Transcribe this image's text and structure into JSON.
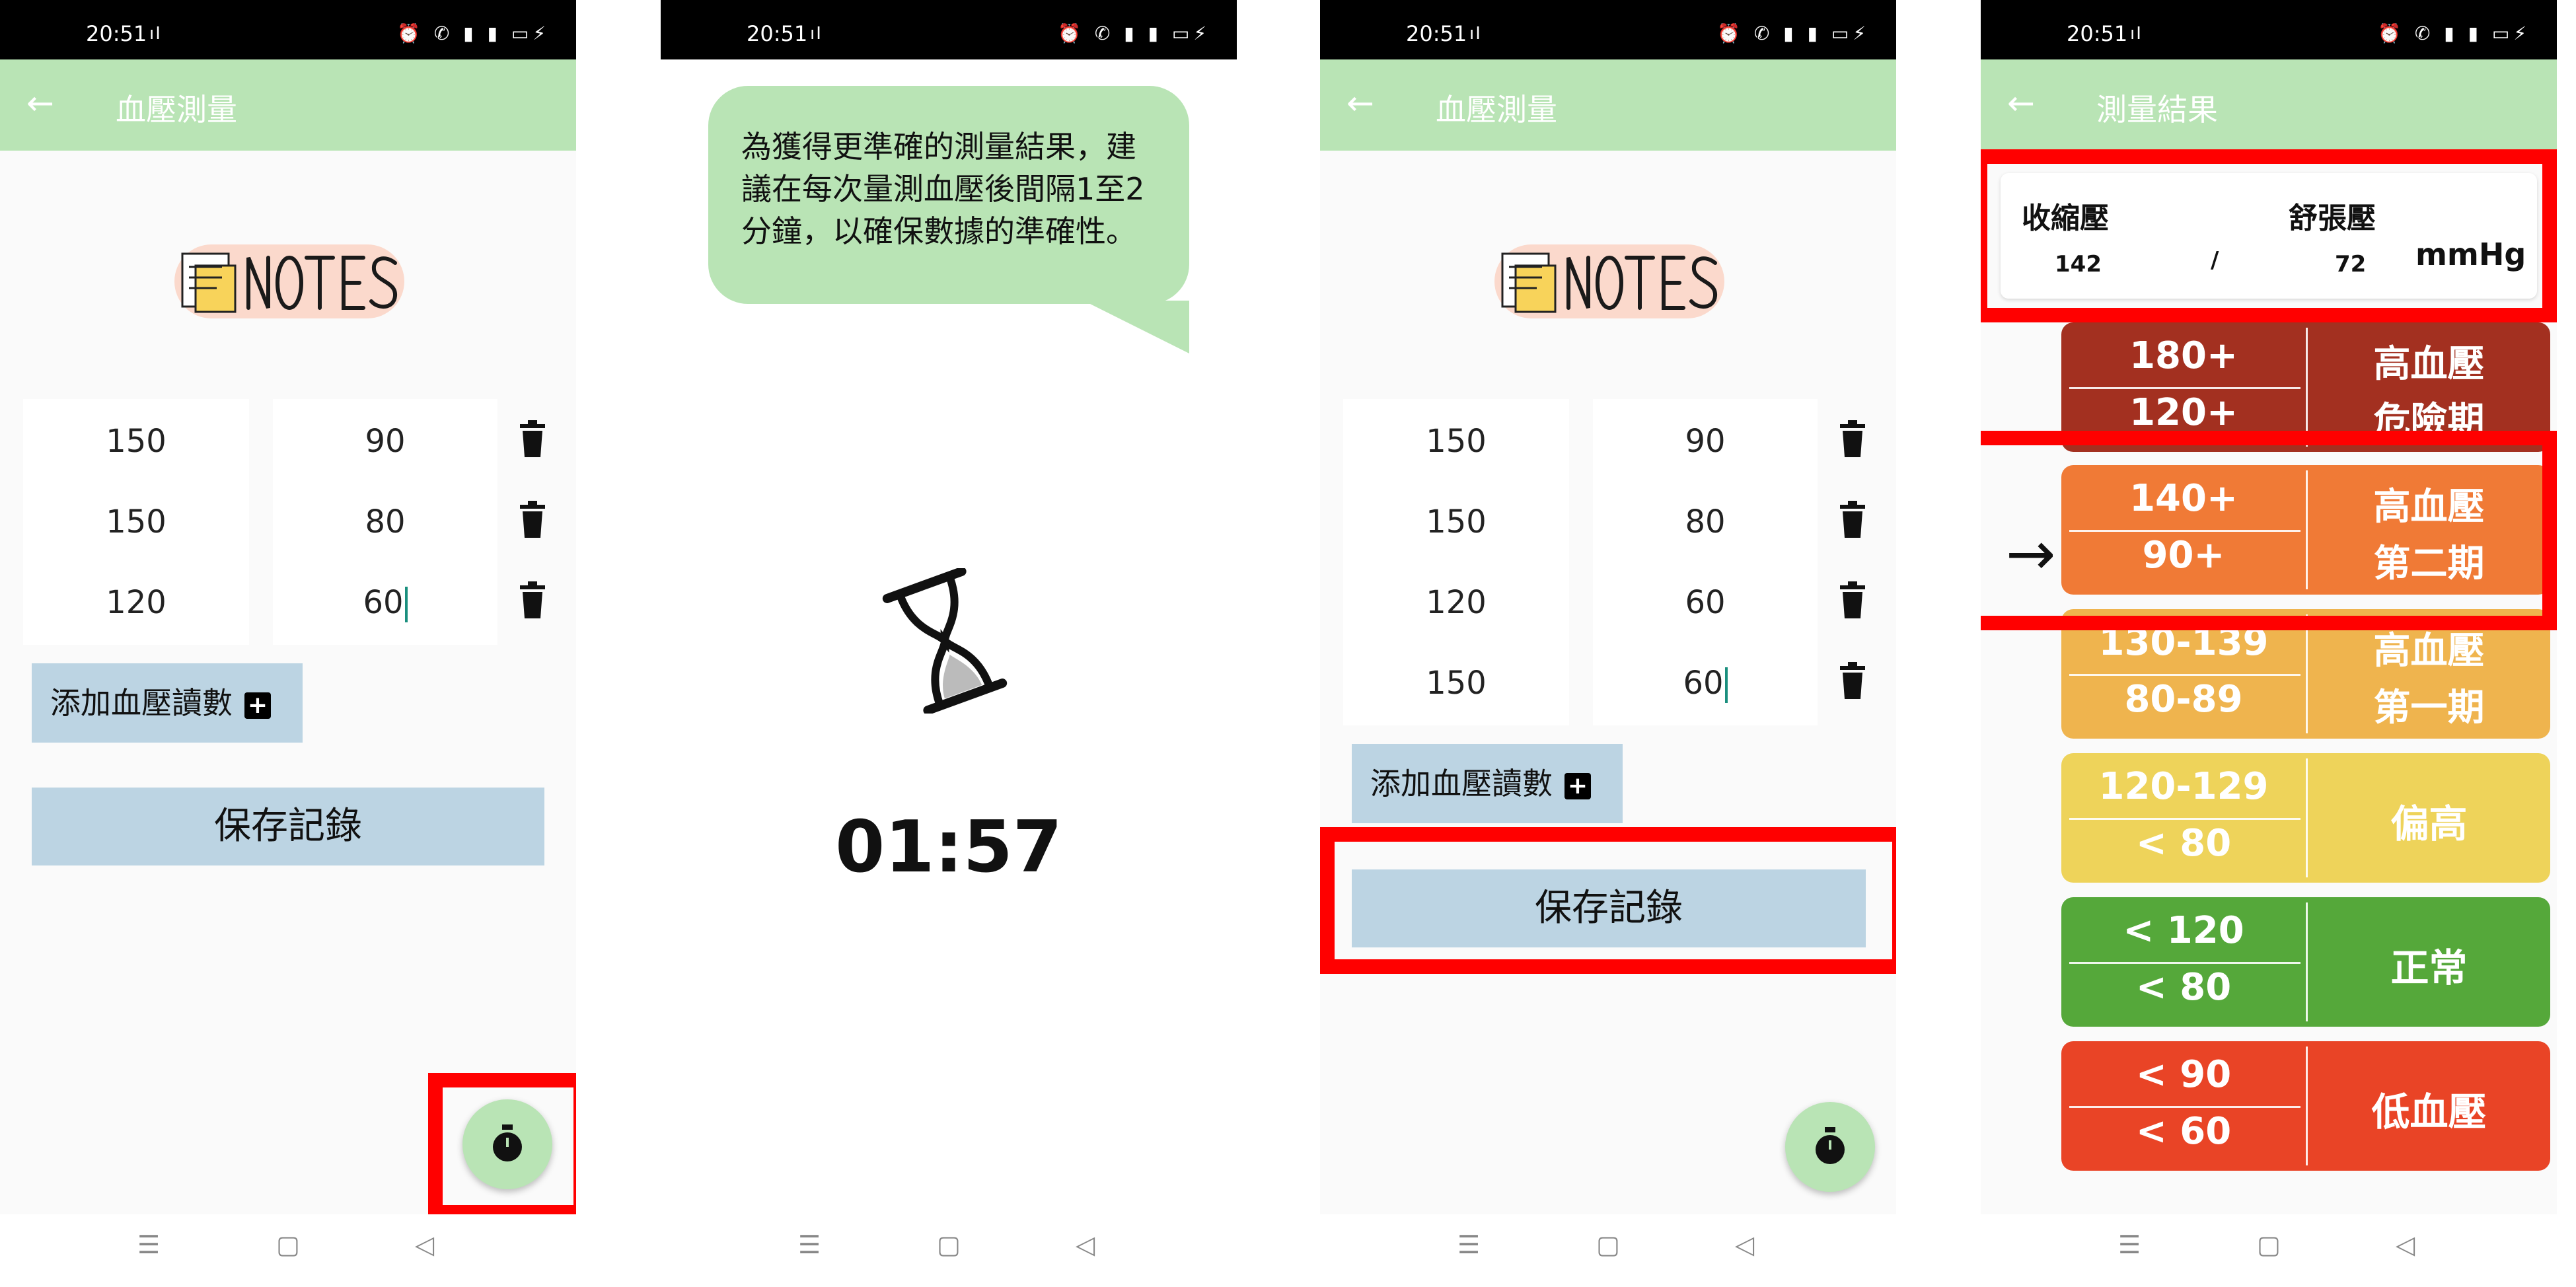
{
  "status": {
    "time": "20:51"
  },
  "screen1": {
    "title": "血壓測量",
    "rows": [
      {
        "sys": "150",
        "dia": "90"
      },
      {
        "sys": "150",
        "dia": "80"
      },
      {
        "sys": "120",
        "dia": "60"
      }
    ],
    "add_label": "添加血壓讀數",
    "save_label": "保存記錄"
  },
  "screen2": {
    "tip_line1": "為獲得更準確的測量結果，建",
    "tip_line2": "議在每次量測血壓後間隔1至2",
    "tip_line3": "分鐘，以確保數據的準確性。",
    "timer": "01:57"
  },
  "screen3": {
    "title": "血壓測量",
    "rows": [
      {
        "sys": "150",
        "dia": "90"
      },
      {
        "sys": "150",
        "dia": "80"
      },
      {
        "sys": "120",
        "dia": "60"
      },
      {
        "sys": "150",
        "dia": "60"
      }
    ],
    "add_label": "添加血壓讀數",
    "save_label": "保存記錄"
  },
  "screen4": {
    "title": "測量結果",
    "systolic_label": "收縮壓",
    "diastolic_label": "舒張壓",
    "systolic": "142",
    "separator": "/",
    "diastolic": "72",
    "unit": "mmHg",
    "categories": [
      {
        "sys": "180+",
        "dia": "120+",
        "name1": "高血壓",
        "name2": "危險期",
        "color": "#a33020"
      },
      {
        "sys": "140+",
        "dia": "90+",
        "name1": "高血壓",
        "name2": "第二期",
        "color": "#f07a36"
      },
      {
        "sys": "130-139",
        "dia": "80-89",
        "name1": "高血壓",
        "name2": "第一期",
        "color": "#efb44e"
      },
      {
        "sys": "120-129",
        "dia": "< 80",
        "name1": "偏高",
        "name2": "",
        "color": "#eed35a"
      },
      {
        "sys": "< 120",
        "dia": "< 80",
        "name1": "正常",
        "name2": "",
        "color": "#55a83a"
      },
      {
        "sys": "< 90",
        "dia": "< 60",
        "name1": "低血壓",
        "name2": "",
        "color": "#e94426"
      }
    ]
  },
  "navbar": {
    "menu": "☰",
    "home": "▢",
    "back": "◁"
  },
  "colors": {
    "appbar": "#b9e4b5",
    "highlight": "#ff0000",
    "button": "#bcd4e3"
  }
}
